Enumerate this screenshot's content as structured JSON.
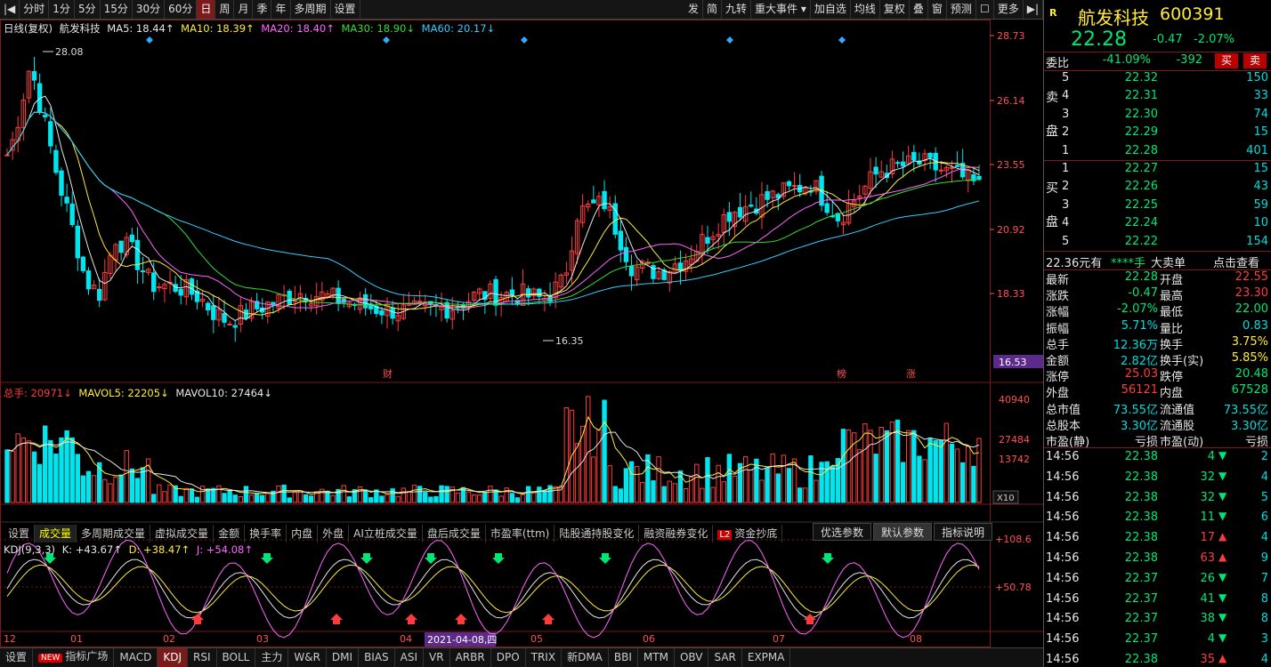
{
  "toolbar": {
    "left": [
      {
        "id": "ctl",
        "label": "|◀"
      },
      {
        "id": "m1",
        "label": "分时"
      },
      {
        "id": "m2",
        "label": "1分"
      },
      {
        "id": "m3",
        "label": "5分"
      },
      {
        "id": "m4",
        "label": "15分"
      },
      {
        "id": "m5",
        "label": "30分"
      },
      {
        "id": "m6",
        "label": "60分"
      },
      {
        "id": "m7",
        "label": "日",
        "active": true
      },
      {
        "id": "m8",
        "label": "周"
      },
      {
        "id": "m9",
        "label": "月"
      },
      {
        "id": "m10",
        "label": "季"
      },
      {
        "id": "m11",
        "label": "年"
      },
      {
        "id": "m12",
        "label": "多周期"
      },
      {
        "id": "m13",
        "label": "设置"
      }
    ],
    "right": [
      {
        "id": "r1",
        "label": "发"
      },
      {
        "id": "r2",
        "label": "简"
      },
      {
        "id": "r3",
        "label": "九转"
      },
      {
        "id": "r4",
        "label": "重大事件 ▾"
      },
      {
        "id": "r5",
        "label": "加自选"
      },
      {
        "id": "r6",
        "label": "均线"
      },
      {
        "id": "r7",
        "label": "复权"
      },
      {
        "id": "r8",
        "label": "叠"
      },
      {
        "id": "r9",
        "label": "窗"
      },
      {
        "id": "r10",
        "label": "预测"
      },
      {
        "id": "r11",
        "label": "☐"
      },
      {
        "id": "r12",
        "label": "更多"
      },
      {
        "id": "r13",
        "label": "▶|"
      }
    ]
  },
  "legend": {
    "period": "日线(复权)",
    "name": "航发科技",
    "ma5": "MA5: 18.44↑",
    "ma10": "MA10: 18.39↑",
    "ma20": "MA20: 18.40↑",
    "ma30": "MA30: 18.90↓",
    "ma60": "MA60: 20.17↓"
  },
  "colors": {
    "ma5": "#e6e6e6",
    "ma10": "#ffeb3b",
    "ma20": "#ff66ff",
    "ma30": "#33dd33",
    "ma60": "#33ccff",
    "up": "#ff3b3b",
    "down": "#00e5ee"
  },
  "price_axis": [
    "28.73",
    "26.14",
    "23.55",
    "20.92",
    "18.33"
  ],
  "current_price_tag": "16.53",
  "annotations": {
    "high": "28.08",
    "low": "16.35",
    "markers": [
      "财",
      "榜",
      "涨"
    ]
  },
  "vol_legend": {
    "total": "总手: 20971↓",
    "mavol5": "MAVOL5: 22205↓",
    "mavol10": "MAVOL10: 27464↓"
  },
  "vol_axis": [
    "40940",
    "27484",
    "13742"
  ],
  "vol_unit": "X10",
  "kline_tabs": [
    "设置",
    "成交量",
    "多周期成交量",
    "虚拟成交量",
    "金额",
    "换手率",
    "内盘",
    "外盘",
    "AI立桩成交量",
    "盘后成交量",
    "市盈率(ttm)",
    "陆股通持股变化",
    "融资融券变化",
    "资金抄底"
  ],
  "kline_badge": "L2",
  "kdj_buttons": [
    "优选参数",
    "默认参数",
    "指标说明"
  ],
  "kdj_legend": {
    "name": "KDJ(9,3,3)",
    "k": "K: +43.67↑",
    "d": "D: +38.47↑",
    "j": "J: +54.08↑"
  },
  "kdj_axis": [
    "+108.6",
    "+50.78"
  ],
  "date_axis": [
    "12",
    "01",
    "02",
    "03",
    "04",
    "05",
    "06",
    "07",
    "08"
  ],
  "date_highlight": "2021-04-08,四",
  "bottom_tabs": [
    "设置",
    "指标广场",
    "MACD",
    "KDJ",
    "RSI",
    "BOLL",
    "主力",
    "W&R",
    "DMI",
    "BIAS",
    "ASI",
    "VR",
    "ARBR",
    "DPO",
    "TRIX",
    "新DMA",
    "BBI",
    "MTM",
    "OBV",
    "SAR",
    "EXPMA"
  ],
  "bottom_new_badge": "NEW",
  "quote": {
    "badge": "R",
    "name": "航发科技",
    "code": "600391",
    "price": "22.28",
    "change": "-0.47",
    "pct": "-2.07%",
    "weibi_label": "委比",
    "weibi_pct": "-41.09%",
    "weibi_val": "-392",
    "buy_btn": "买",
    "sell_btn": "卖",
    "sell_side_label": [
      "卖",
      "盘"
    ],
    "buy_side_label": [
      "买",
      "盘"
    ],
    "asks": [
      {
        "lvl": "5",
        "price": "22.32",
        "vol": "150"
      },
      {
        "lvl": "4",
        "price": "22.31",
        "vol": "33"
      },
      {
        "lvl": "3",
        "price": "22.30",
        "vol": "74"
      },
      {
        "lvl": "2",
        "price": "22.29",
        "vol": "15"
      },
      {
        "lvl": "1",
        "price": "22.28",
        "vol": "401"
      }
    ],
    "bids": [
      {
        "lvl": "1",
        "price": "22.27",
        "vol": "15"
      },
      {
        "lvl": "2",
        "price": "22.26",
        "vol": "43"
      },
      {
        "lvl": "3",
        "price": "22.25",
        "vol": "59"
      },
      {
        "lvl": "4",
        "price": "22.24",
        "vol": "10"
      },
      {
        "lvl": "5",
        "price": "22.22",
        "vol": "154"
      }
    ],
    "bigorder": {
      "price": "22.36元有",
      "stars": "****手",
      "label": "大卖单",
      "link": "点击查看"
    },
    "stats": [
      [
        "最新",
        "22.28",
        "grn",
        "开盘",
        "22.55",
        "red"
      ],
      [
        "涨跌",
        "-0.47",
        "grn",
        "最高",
        "23.30",
        "red"
      ],
      [
        "涨幅",
        "-2.07%",
        "grn",
        "最低",
        "22.00",
        "grn"
      ],
      [
        "振幅",
        "5.71%",
        "cy",
        "量比",
        "0.83",
        "cy"
      ],
      [
        "总手",
        "12.36万",
        "cy",
        "换手",
        "3.75%",
        "yel"
      ],
      [
        "金额",
        "2.82亿",
        "cy",
        "换手(实)",
        "5.85%",
        "yel"
      ],
      [
        "涨停",
        "25.03",
        "red",
        "跌停",
        "20.48",
        "grn"
      ],
      [
        "外盘",
        "56121",
        "red",
        "内盘",
        "67528",
        "grn"
      ],
      [
        "总市值",
        "73.55亿",
        "cy",
        "流通值",
        "73.55亿",
        "cy"
      ],
      [
        "总股本",
        "3.30亿",
        "cy",
        "流通股",
        "3.30亿",
        "cy"
      ],
      [
        "市盈(静)",
        "亏损",
        "wht",
        "市盈(动)",
        "亏损",
        "wht"
      ]
    ],
    "ticks": [
      {
        "t": "14:56",
        "p": "22.38",
        "v": "4",
        "d": "down",
        "n": "2"
      },
      {
        "t": "14:56",
        "p": "22.38",
        "v": "32",
        "d": "down",
        "n": "4"
      },
      {
        "t": "14:56",
        "p": "22.38",
        "v": "32",
        "d": "down",
        "n": "5"
      },
      {
        "t": "14:56",
        "p": "22.38",
        "v": "11",
        "d": "down",
        "n": "6"
      },
      {
        "t": "14:56",
        "p": "22.38",
        "v": "17",
        "d": "up",
        "n": "4"
      },
      {
        "t": "14:56",
        "p": "22.38",
        "v": "63",
        "d": "up",
        "n": "9"
      },
      {
        "t": "14:56",
        "p": "22.37",
        "v": "26",
        "d": "down",
        "n": "7"
      },
      {
        "t": "14:56",
        "p": "22.37",
        "v": "41",
        "d": "down",
        "n": "8"
      },
      {
        "t": "14:56",
        "p": "22.37",
        "v": "38",
        "d": "down",
        "n": "8"
      },
      {
        "t": "14:56",
        "p": "22.37",
        "v": "4",
        "d": "down",
        "n": "3"
      },
      {
        "t": "14:56",
        "p": "22.38",
        "v": "35",
        "d": "up",
        "n": "4"
      }
    ]
  }
}
